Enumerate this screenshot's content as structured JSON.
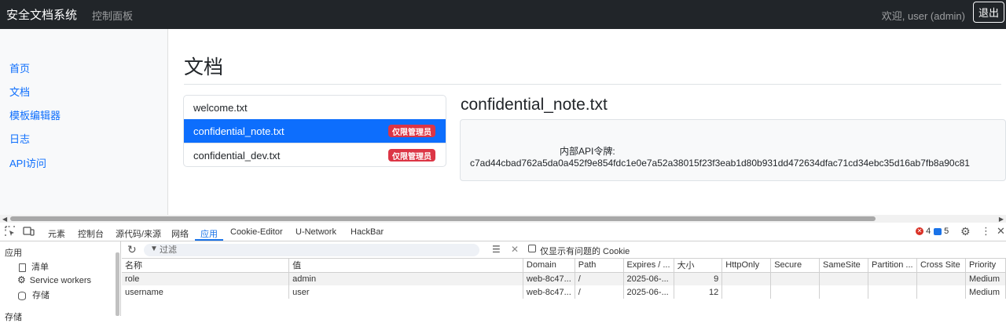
{
  "navbar": {
    "brand": "安全文档系统",
    "link": "控制面板",
    "welcome": "欢迎, user (admin)",
    "logout": "退出"
  },
  "sidebar": {
    "items": [
      {
        "label": "首页"
      },
      {
        "label": "文档"
      },
      {
        "label": "模板编辑器"
      },
      {
        "label": "日志"
      },
      {
        "label": "API访问"
      }
    ]
  },
  "main": {
    "title": "文档",
    "documents": [
      {
        "name": "welcome.txt",
        "badge": "",
        "active": false
      },
      {
        "name": "confidential_note.txt",
        "badge": "仅限管理员",
        "active": true
      },
      {
        "name": "confidential_dev.txt",
        "badge": "仅限管理员",
        "active": false
      }
    ],
    "viewer": {
      "title": "confidential_note.txt",
      "line1": "内部API令牌:",
      "line2": "c7ad44cbad762a5da0a452f9e854fdc1e0e7a52a38015f23f3eab1d80b931dd472634dfac71cd34ebc35d16ab7fb8a90c81"
    }
  },
  "devtools": {
    "tabs": [
      "元素",
      "控制台",
      "源代码/来源",
      "网络",
      "应用",
      "Cookie-Editor",
      "U-Network",
      "HackBar"
    ],
    "active_tab": "应用",
    "errors": "4",
    "messages": "5",
    "sidebar": {
      "section": "应用",
      "items": [
        "清单",
        "Service workers",
        "存储"
      ],
      "next_section": "存储"
    },
    "toolbar": {
      "filter_placeholder": "过滤",
      "only_issues_label": "仅显示有问题的 Cookie"
    },
    "table": {
      "columns": [
        "名称",
        "值",
        "Domain",
        "Path",
        "Expires / ...",
        "大小",
        "HttpOnly",
        "Secure",
        "SameSite",
        "Partition ...",
        "Cross Site",
        "Priority"
      ],
      "rows": [
        [
          "role",
          "admin",
          "web-8c47...",
          "/",
          "2025-06-...",
          "9",
          "",
          "",
          "",
          "",
          "",
          "Medium"
        ],
        [
          "username",
          "user",
          "web-8c47...",
          "/",
          "2025-06-...",
          "12",
          "",
          "",
          "",
          "",
          "",
          "Medium"
        ]
      ]
    }
  },
  "colors": {
    "navbar": "#212529",
    "link": "#0d6efd",
    "active": "#0d6efd",
    "badge": "#dc3545",
    "devtools_accent": "#1a73e8"
  }
}
